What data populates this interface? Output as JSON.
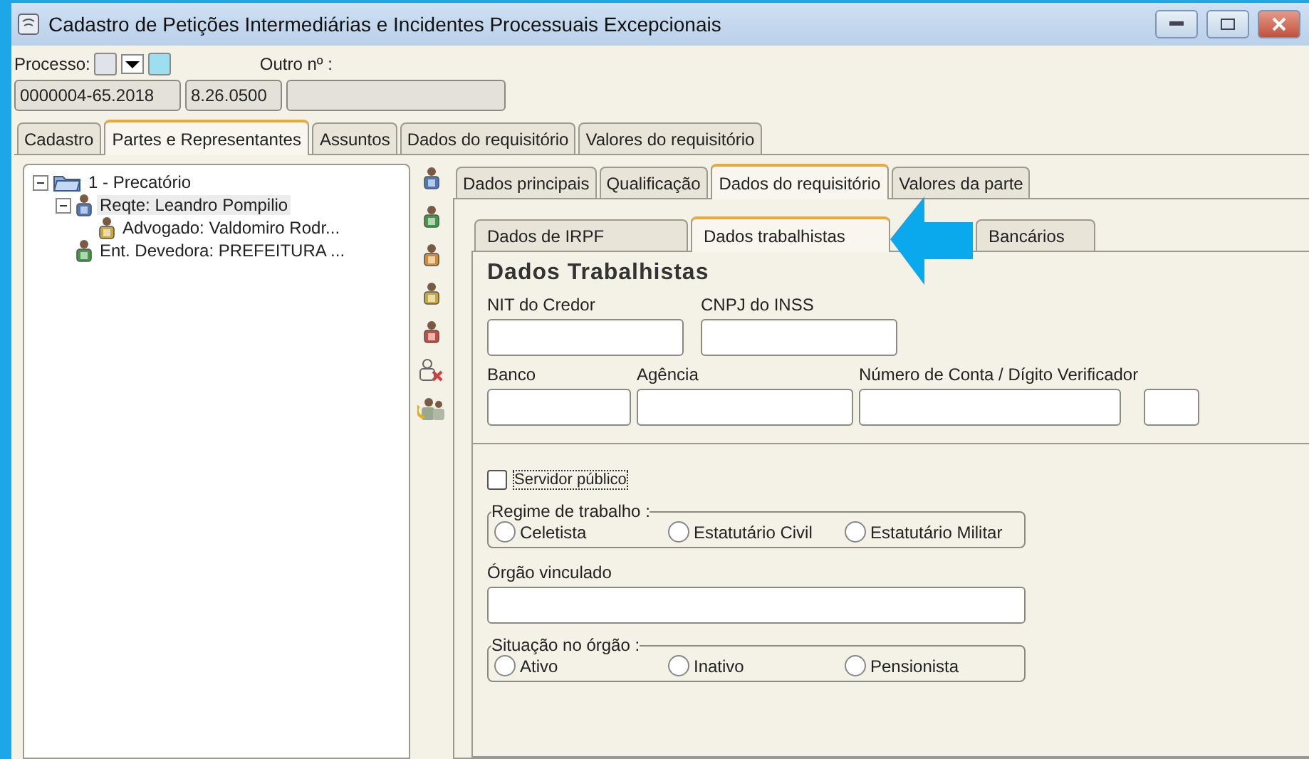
{
  "window": {
    "title": "Cadastro de Petições Intermediárias e Incidentes Processuais Excepcionais"
  },
  "processo": {
    "label": "Processo:",
    "outro_label": "Outro nº :",
    "fields": [
      "0000004-65.2018",
      "8.26.0500"
    ]
  },
  "main_tabs": [
    {
      "label": "Cadastro",
      "selected": false
    },
    {
      "label": "Partes e Representantes",
      "selected": true
    },
    {
      "label": "Assuntos",
      "selected": false
    },
    {
      "label": "Dados do requisitório",
      "selected": false
    },
    {
      "label": "Valores do requisitório",
      "selected": false
    }
  ],
  "tree": [
    {
      "kind": "folder",
      "label": "1 - Precatório",
      "selected": false,
      "expanded": true,
      "children": [
        {
          "kind": "person",
          "color": "#4a78c0",
          "label": "Reqte: Leandro Pompilio",
          "selected": true,
          "expanded": true,
          "children": [
            {
              "kind": "person",
              "color": "#c8a83a",
              "label": "Advogado: Valdomiro Rodr...",
              "selected": false
            }
          ]
        },
        {
          "kind": "person",
          "color": "#3f9a45",
          "label": "Ent. Devedora: PREFEITURA ...",
          "selected": false
        }
      ]
    }
  ],
  "party_tools": [
    {
      "kind": "person",
      "color": "#4a78c0"
    },
    {
      "kind": "person",
      "color": "#3f9a45"
    },
    {
      "kind": "person",
      "color": "#d08a30"
    },
    {
      "kind": "person",
      "color": "#c8a83a"
    },
    {
      "kind": "person",
      "color": "#c84a3a"
    },
    {
      "kind": "remove"
    },
    {
      "kind": "swap"
    }
  ],
  "party_tabs": [
    {
      "label": "Dados principais",
      "selected": false
    },
    {
      "label": "Qualificação",
      "selected": false
    },
    {
      "label": "Dados do requisitório",
      "selected": true
    },
    {
      "label": "Valores da parte",
      "selected": false
    }
  ],
  "sub_tabs": [
    {
      "label": "Dados de IRPF",
      "selected": false
    },
    {
      "label": "Dados trabalhistas",
      "selected": true
    },
    {
      "label": "Bancários",
      "selected": false
    }
  ],
  "form": {
    "heading": "Dados Trabalhistas",
    "row1": [
      {
        "label": "NIT do Credor"
      },
      {
        "label": "CNPJ do INSS"
      }
    ],
    "row2": [
      {
        "label": "Banco"
      },
      {
        "label": "Agência"
      },
      {
        "label": "Número de Conta / Dígito Verificador"
      },
      {
        "kind": "digit"
      }
    ],
    "servidor": {
      "label": "Servidor público",
      "checked": false
    },
    "regime": {
      "legend": "Regime de trabalho :",
      "options": [
        {
          "label": "Celetista",
          "selected": false
        },
        {
          "label": "Estatutário Civil",
          "selected": false
        },
        {
          "label": "Estatutário Militar",
          "selected": false
        }
      ]
    },
    "orgao": {
      "label": "Órgão vinculado"
    },
    "situacao": {
      "legend": "Situação no órgão :",
      "options": [
        {
          "label": "Ativo",
          "selected": false
        },
        {
          "label": "Inativo",
          "selected": false
        },
        {
          "label": "Pensionista",
          "selected": false
        }
      ]
    }
  }
}
